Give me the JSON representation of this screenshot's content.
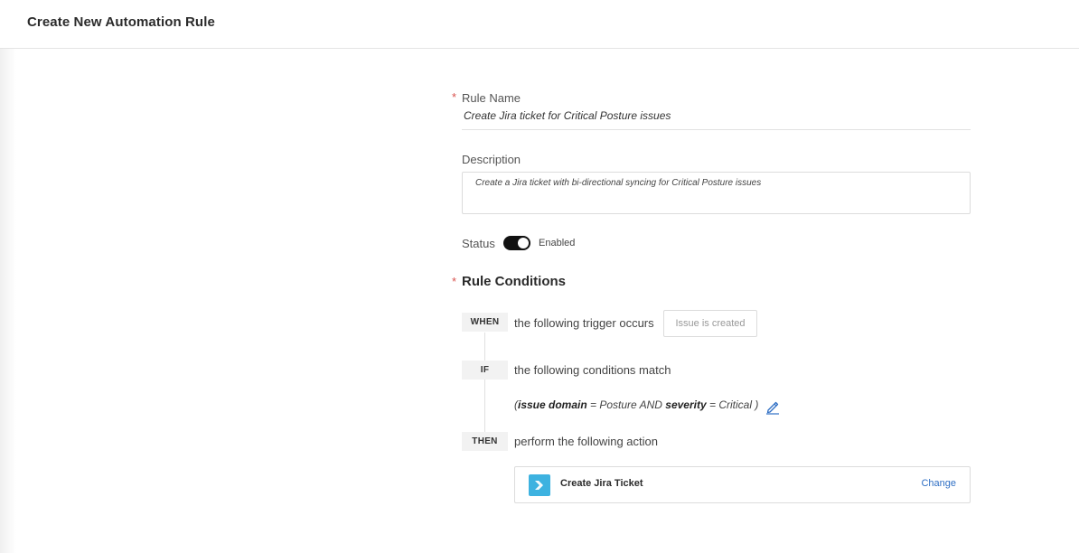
{
  "header": {
    "title": "Create New Automation Rule"
  },
  "form": {
    "required_marker": "*",
    "rule_name": {
      "label": "Rule Name",
      "value": "Create Jira ticket for Critical Posture issues"
    },
    "description": {
      "label": "Description",
      "value": "Create a Jira ticket with bi-directional syncing for Critical Posture issues"
    },
    "status": {
      "label": "Status",
      "value": "Enabled",
      "enabled": true
    }
  },
  "conditions": {
    "title": "Rule Conditions",
    "when": {
      "tag": "WHEN",
      "text": "the following trigger occurs",
      "trigger": "Issue is created"
    },
    "if": {
      "tag": "IF",
      "text": "the following conditions match",
      "expr": {
        "open": "(",
        "field1": "issue domain",
        "op1": " = Posture AND ",
        "field2": "severity",
        "op2": " = Critical )"
      }
    },
    "then": {
      "tag": "THEN",
      "text": "perform the following action",
      "action": {
        "name": "Create Jira Ticket",
        "change": "Change",
        "icon": "jira-icon"
      }
    }
  },
  "colors": {
    "accent_link": "#2f6fc4",
    "required": "#d9534f",
    "jira": "#3db2e0",
    "toggle_on": "#111111"
  }
}
